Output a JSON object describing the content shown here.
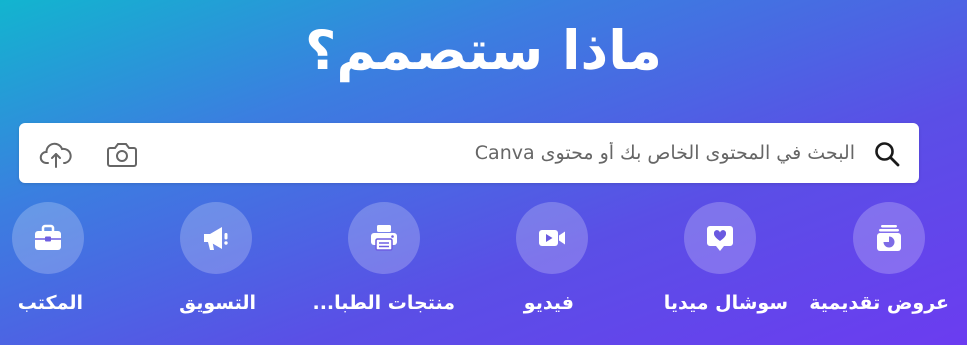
{
  "hero": {
    "title": "ماذا ستصمم؟"
  },
  "search": {
    "placeholder": "البحث في المحتوى الخاص بك أو محتوى Canva",
    "icons": [
      "search-icon",
      "camera-icon",
      "upload-cloud-icon"
    ]
  },
  "categories": [
    {
      "label": "عروض تقديمية",
      "icon": "presentation-icon"
    },
    {
      "label": "سوشال ميديا",
      "icon": "social-media-heart-icon"
    },
    {
      "label": "فيديو",
      "icon": "video-camera-icon"
    },
    {
      "label": "منتجات الطبا...",
      "icon": "printer-icon"
    },
    {
      "label": "التسويق",
      "icon": "megaphone-icon"
    },
    {
      "label": "المكتب",
      "icon": "briefcase-icon"
    }
  ],
  "colors": {
    "gradient_start": "#12b5cf",
    "gradient_end": "#6b3cf0",
    "text": "#ffffff"
  }
}
